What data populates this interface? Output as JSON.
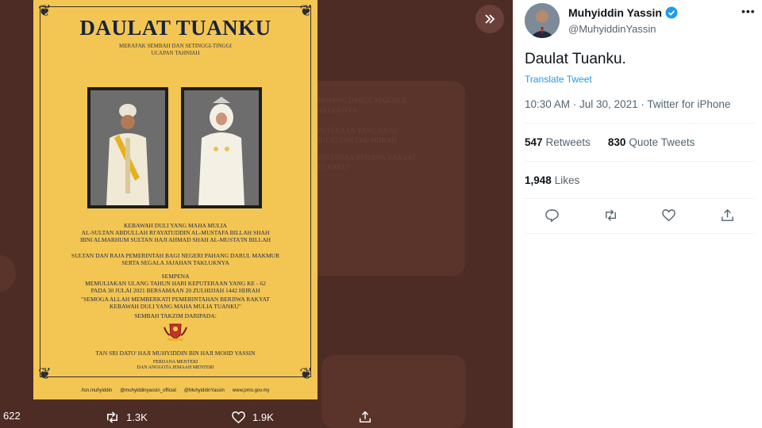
{
  "viewer": {
    "poster": {
      "title": "DAULAT TUANKU",
      "subtitle_1": "MERAFAK SEMBAH DAN SETINGGI-TINGGI",
      "subtitle_2": "UCAPAN TAHNIAH",
      "lines_block_1": [
        "KEBAWAH DULI YANG MAHA MULIA",
        "AL-SULTAN ABDULLAH RI'AYATUDDIN AL-MUSTAFA BILLAH SHAH",
        "IBNI ALMARHUM SULTAN HAJI AHMAD SHAH AL-MUSTA'IN BILLAH"
      ],
      "lines_block_2": [
        "SULTAN DAN RAJA PEMERINTAH BAGI NEGERI PAHANG DARUL MAKMUR",
        "SERTA SEGALA JAJAHAN TAKLUKNYA"
      ],
      "lines_block_3": [
        "SEMPENA",
        "MEMULIAKAN ULANG TAHUN HARI KEPUTERAAN YANG KE - 62",
        "PADA 30 JULAI 2021 BERSAMAAN 20 ZULHIJJAH 1442 HIJRAH"
      ],
      "lines_block_4": [
        "\"SEMOGA ALLAH MEMBERKATI PEMERINTAHAN BERJIWA RAKYAT",
        "KEBAWAH DULI YANG MAHA MULIA TUANKU\""
      ],
      "sembah": "SEMBAH TAKZIM DARIPADA:",
      "signatory": "TAN SRI DATO' HAJI MUHYIDDIN BIN HAJI MOHD YASSIN",
      "role_1": "PERDANA MENTERI",
      "role_2": "DAN ANGGOTA JEMAAH MENTERI",
      "footer": [
        "/tsn.muhyiddin",
        "@muhyiddinyassin_official",
        "@MuhyiddinYassin",
        "www.pmo.gov.my"
      ]
    },
    "background_ghost": [
      "PAHANG DARUL MAKMUR",
      "AKLUKNYA",
      "PUTERAAN YANG KE-62",
      "JULHIJJAH 1442 HIJRAH",
      "RINTAHAN BERJIWA RAKYAT",
      "TUANKU\""
    ],
    "actions": {
      "replies": "622",
      "retweets": "1.3K",
      "likes": "1.9K"
    }
  },
  "tweet": {
    "author_name": "Muhyiddin Yassin",
    "author_handle": "@MuhyiddinYassin",
    "text": "Daulat Tuanku.",
    "translate": "Translate Tweet",
    "meta": "10:30 AM · Jul 30, 2021 · Twitter for iPhone",
    "retweets_count": "547",
    "retweets_label": "Retweets",
    "quote_count": "830",
    "quote_label": "Quote Tweets",
    "likes_count": "1,948",
    "likes_label": "Likes"
  },
  "colors": {
    "accent": "#1d9bf0",
    "verified": "#1d9bf0",
    "poster_bg": "#f3c553",
    "poster_title": "#18233f"
  }
}
